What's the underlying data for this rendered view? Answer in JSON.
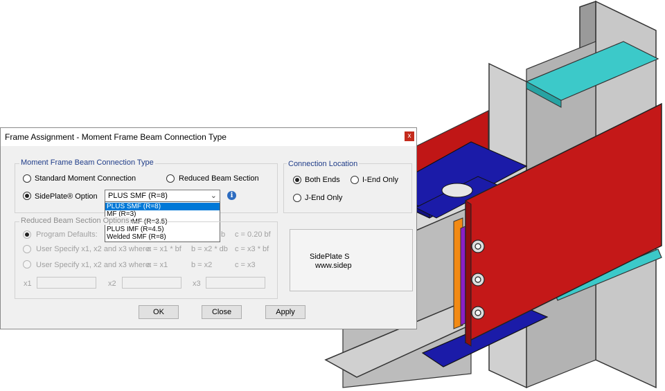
{
  "dialog": {
    "title": "Frame Assignment - Moment Frame Beam Connection Type",
    "close_label": "x"
  },
  "connection_type": {
    "group_label": "Moment Frame Beam Connection Type",
    "standard": "Standard Moment Connection",
    "reduced": "Reduced Beam Section",
    "sideplate": "SidePlate® Option",
    "selected_value": "PLUS SMF (R=8)",
    "options": [
      "PLUS SMF (R=8)",
      "MF (R=3)",
      "PLUS OMF (R=3.5)",
      "PLUS IMF (R=4.5)",
      "Welded SMF (R=8)"
    ]
  },
  "location": {
    "group_label": "Connection Location",
    "both": "Both Ends",
    "i_end": "I-End Only",
    "j_end": "J-End Only"
  },
  "rbs": {
    "group_label": "Reduced Beam Section Options",
    "row1": {
      "label": "Program Defaults:",
      "a": "",
      "b": "b",
      "c": "c = 0.20 bf"
    },
    "row2": {
      "label": "User Specify x1,  x2 and x3 where:",
      "a": "a = x1 * bf",
      "b": "b = x2 * db",
      "c": "c = x3 * bf"
    },
    "row3": {
      "label": "User Specify x1,  x2 and x3 where:",
      "a": "a = x1",
      "b": "b = x2",
      "c": "c = x3"
    },
    "x1": "x1",
    "x2": "x2",
    "x3": "x3"
  },
  "sideplate_box": {
    "line1": "SidePlate S",
    "line2": "www.sidep"
  },
  "buttons": {
    "ok": "OK",
    "close": "Close",
    "apply": "Apply"
  },
  "icons": {
    "info": "info-icon"
  }
}
